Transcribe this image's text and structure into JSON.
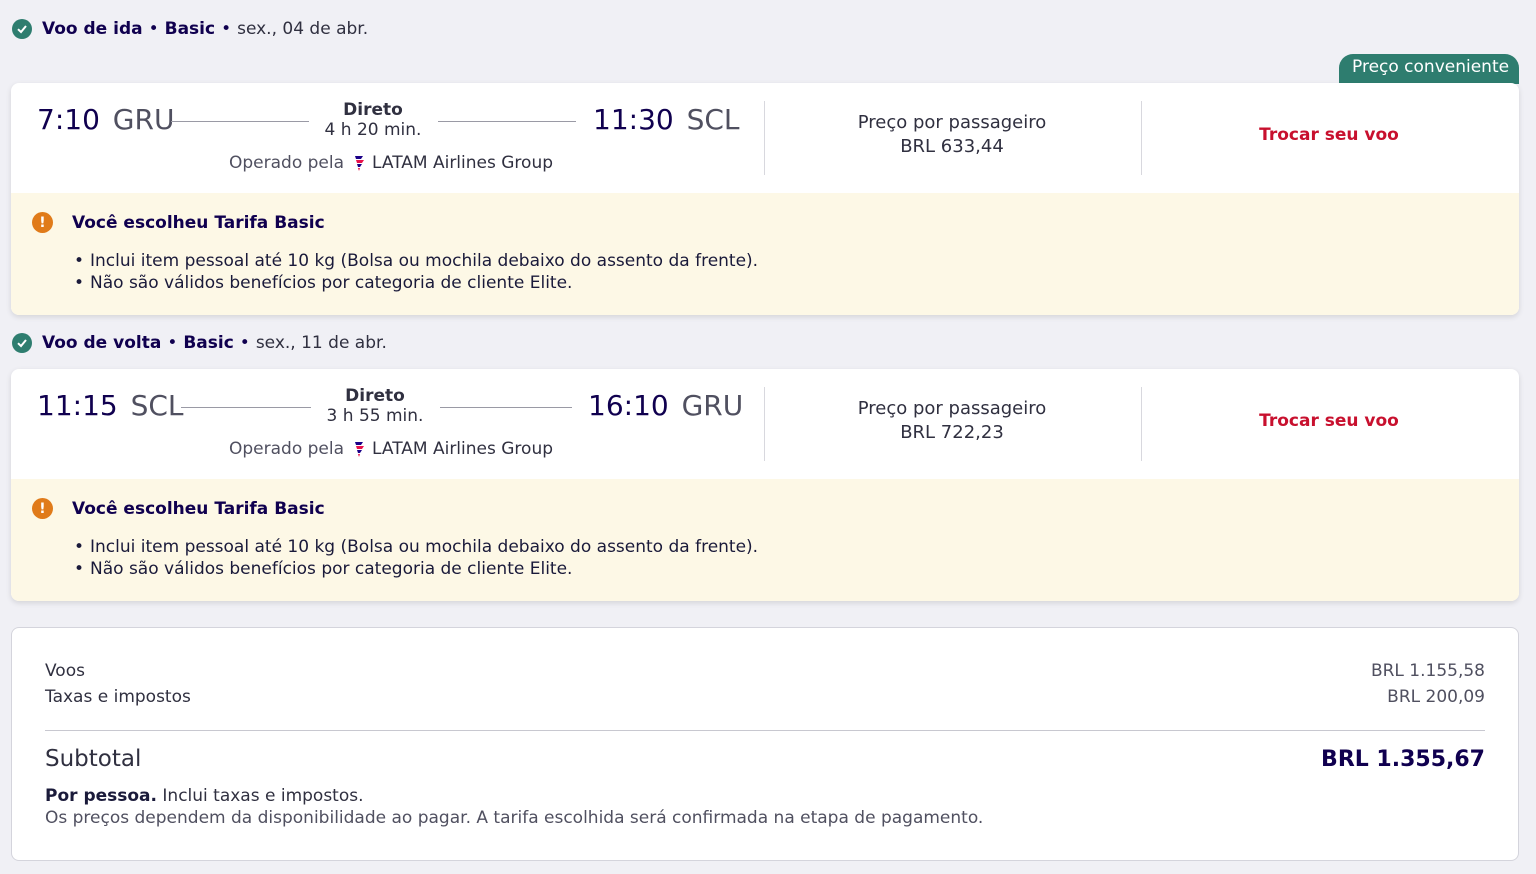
{
  "outbound": {
    "header": {
      "label": "Voo de ida",
      "fare": "Basic",
      "date": "sex., 04 de abr."
    },
    "badge": "Preço conveniente",
    "dep_time": "7:10",
    "dep_code": "GRU",
    "arr_time": "11:30",
    "arr_code": "SCL",
    "direct": "Direto",
    "duration": "4 h 20 min.",
    "operated_label": "Operado pela",
    "airline": "LATAM Airlines Group",
    "price_label": "Preço por passageiro",
    "price": "BRL 633,44",
    "change_label": "Trocar seu voo",
    "notice_title": "Você escolheu Tarifa Basic",
    "notice_items": [
      "Inclui item pessoal até 10 kg (Bolsa ou mochila debaixo do assento da frente).",
      "Não são válidos benefícios por categoria de cliente Elite."
    ]
  },
  "inbound": {
    "header": {
      "label": "Voo de volta",
      "fare": "Basic",
      "date": "sex., 11 de abr."
    },
    "dep_time": "11:15",
    "dep_code": "SCL",
    "arr_time": "16:10",
    "arr_code": "GRU",
    "direct": "Direto",
    "duration": "3 h 55 min.",
    "operated_label": "Operado pela",
    "airline": "LATAM Airlines Group",
    "price_label": "Preço por passageiro",
    "price": "BRL 722,23",
    "change_label": "Trocar seu voo",
    "notice_title": "Você escolheu Tarifa Basic",
    "notice_items": [
      "Inclui item pessoal até 10 kg (Bolsa ou mochila debaixo do assento da frente).",
      "Não são válidos benefícios por categoria de cliente Elite."
    ]
  },
  "summary": {
    "flights_label": "Voos",
    "flights_value": "BRL 1.155,58",
    "taxes_label": "Taxas e impostos",
    "taxes_value": "BRL 200,09",
    "subtotal_label": "Subtotal",
    "subtotal_value": "BRL 1.355,67",
    "per_person_bold": "Por pessoa.",
    "per_person_text": "Inclui taxas e impostos.",
    "disclaimer": "Os preços dependem da disponibilidade ao pagar. A tarifa escolhida será confirmada na etapa de pagamento."
  },
  "colors": {
    "accent": "#1b0088",
    "badge": "#2e7d6f",
    "link": "#c8102e",
    "notice_bg": "#fdf8e6",
    "warn": "#e07b1a"
  }
}
